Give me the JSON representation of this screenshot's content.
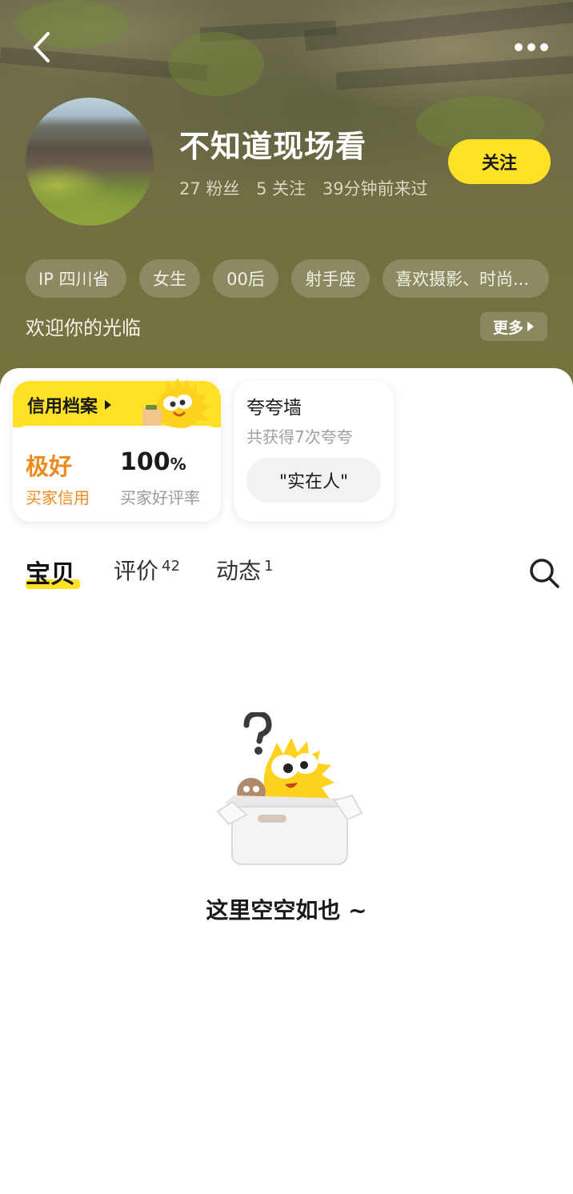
{
  "header": {
    "user_name": "不知道现场看",
    "stats": {
      "fans": "27 粉丝",
      "following": "5 关注",
      "last_seen": "39分钟前来过"
    },
    "follow_label": "关注",
    "tags": [
      "IP 四川省",
      "女生",
      "00后",
      "射手座",
      "喜欢摄影、时尚..."
    ],
    "bio": "欢迎你的光临",
    "more_label": "更多"
  },
  "credit_card": {
    "title": "信用档案",
    "level": "极好",
    "level_label": "买家信用",
    "rate_value": "100",
    "rate_unit": "%",
    "rate_label": "买家好评率"
  },
  "praise_card": {
    "title": "夸夸墙",
    "subtitle": "共获得7次夸夸",
    "chip": "\"实在人\""
  },
  "tabs": [
    {
      "label": "宝贝",
      "count": ""
    },
    {
      "label": "评价",
      "count": "42"
    },
    {
      "label": "动态",
      "count": "1"
    }
  ],
  "empty_state": {
    "text": "这里空空如也 ~"
  },
  "colors": {
    "accent_yellow": "#ffe126",
    "credit_orange": "#ef8b1e",
    "header_olive": "#6f6b47"
  },
  "icons": [
    "back-icon",
    "more-icon",
    "search-icon",
    "chevron-right-icon"
  ]
}
